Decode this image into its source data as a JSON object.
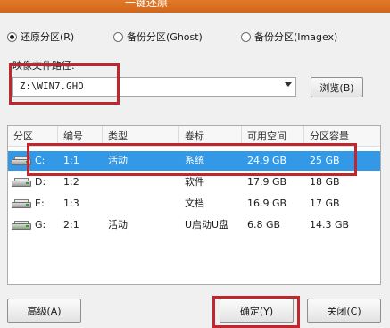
{
  "window": {
    "title": "一键还原"
  },
  "mode_options": [
    {
      "label": "还原分区(R)",
      "selected": true
    },
    {
      "label": "备份分区(Ghost)",
      "selected": false
    },
    {
      "label": "备份分区(Imagex)",
      "selected": false
    }
  ],
  "image_path": {
    "label": "映像文件路径:",
    "value": "Z:\\WIN7.GHO",
    "browse_label": "浏览(B)"
  },
  "table": {
    "columns": [
      "分区",
      "编号",
      "类型",
      "卷标",
      "可用空间",
      "分区容量"
    ],
    "rows": [
      {
        "drive": "C:",
        "number": "1:1",
        "type": "活动",
        "label": "系统",
        "free": "24.9 GB",
        "size": "25 GB",
        "selected": true,
        "disk_icon": "hard-disk-icon"
      },
      {
        "drive": "D:",
        "number": "1:2",
        "type": "",
        "label": "软件",
        "free": "17.9 GB",
        "size": "18 GB",
        "selected": false,
        "disk_icon": "hard-disk-icon"
      },
      {
        "drive": "E:",
        "number": "1:3",
        "type": "",
        "label": "文档",
        "free": "16.9 GB",
        "size": "17 GB",
        "selected": false,
        "disk_icon": "hard-disk-icon"
      },
      {
        "drive": "G:",
        "number": "2:1",
        "type": "活动",
        "label": "U启动U盘",
        "free": "6.8 GB",
        "size": "14.3 GB",
        "selected": false,
        "disk_icon": "usb-disk-icon"
      }
    ]
  },
  "buttons": {
    "advanced": "高级(A)",
    "ok": "确定(Y)",
    "close": "关闭(C)"
  },
  "colors": {
    "highlight_border": "#c0262d",
    "selection": "#3399e6",
    "title_bar": "#d2661a"
  }
}
